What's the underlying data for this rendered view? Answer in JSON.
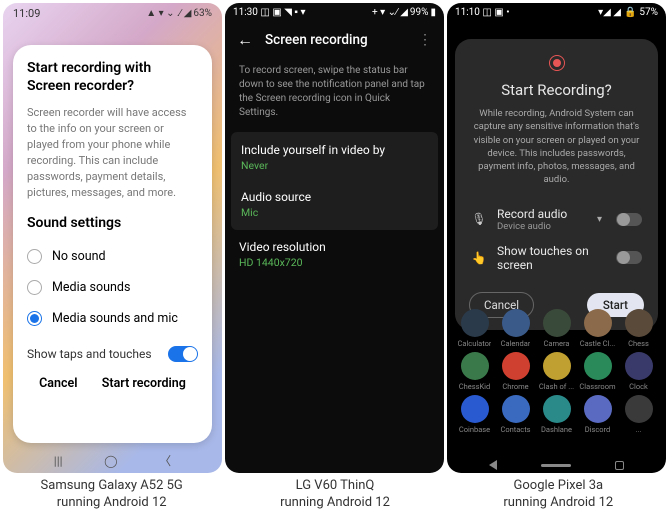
{
  "phone1": {
    "status": {
      "time": "11:09",
      "icons": "◧",
      "battery": "63%",
      "signal": "▲ ▾ ⌄ .∕ ◢"
    },
    "title": "Start recording with Screen recorder?",
    "body": "Screen recorder will have access to the info on your screen or played from your phone while recording. This can include passwords, payment details, pictures, messages, and more.",
    "section": "Sound settings",
    "options": [
      "No sound",
      "Media sounds",
      "Media sounds and mic"
    ],
    "toggle_label": "Show taps and touches",
    "cancel": "Cancel",
    "start": "Start recording"
  },
  "phone2": {
    "status": {
      "time": "11:30",
      "left_icons": "◫ ▣ ◥ ▪ ▾",
      "battery": "99%",
      "signal": "+ ▾ ⌄∕ ◢"
    },
    "title": "Screen recording",
    "desc": "To record screen, swipe the status bar down to see the notification panel and tap the Screen recording icon in Quick Settings.",
    "items": [
      {
        "label": "Include yourself in video by",
        "value": "Never"
      },
      {
        "label": "Audio source",
        "value": "Mic"
      },
      {
        "label": "Video resolution",
        "value": "HD 1440x720"
      }
    ]
  },
  "phone3": {
    "status": {
      "time": "11:10",
      "left_icons": "◫ ▣ •",
      "battery": "57%",
      "signal": "▾◢ ◢"
    },
    "title": "Start Recording?",
    "body": "While recording, Android System can capture any sensitive information that's visible on your screen or played on your device. This includes passwords, payment info, photos, messages, and audio.",
    "row1": {
      "label": "Record audio",
      "sub": "Device audio"
    },
    "row2": {
      "label": "Show touches on screen"
    },
    "cancel": "Cancel",
    "start": "Start",
    "apps": [
      {
        "l": "Calculator",
        "c": "#2a3a4a"
      },
      {
        "l": "Calendar",
        "c": "#3a5a8a"
      },
      {
        "l": "Camera",
        "c": "#3a4a3a"
      },
      {
        "l": "Castle Cl...",
        "c": "#8a6a4a"
      },
      {
        "l": "Chess",
        "c": "#5a4a3a"
      },
      {
        "l": "ChessKid",
        "c": "#3a7a4a"
      },
      {
        "l": "Chrome",
        "c": "#d04030"
      },
      {
        "l": "Clash of ...",
        "c": "#c0a030"
      },
      {
        "l": "Classroom",
        "c": "#2a8a5a"
      },
      {
        "l": "Clock",
        "c": "#3a3a6a"
      },
      {
        "l": "Coinbase",
        "c": "#2a5ad0"
      },
      {
        "l": "Contacts",
        "c": "#3a6ac0"
      },
      {
        "l": "Dashlane",
        "c": "#2a8a8a"
      },
      {
        "l": "Discord",
        "c": "#5a6ac0"
      },
      {
        "l": "...",
        "c": "#3a3a3a"
      }
    ]
  },
  "captions": [
    {
      "l1": "Samsung Galaxy A52 5G",
      "l2": "running Android 12"
    },
    {
      "l1": "LG V60 ThinQ",
      "l2": "running Android 12"
    },
    {
      "l1": "Google Pixel 3a",
      "l2": "running Android 12"
    }
  ]
}
